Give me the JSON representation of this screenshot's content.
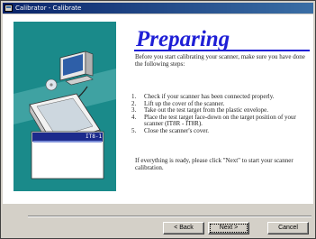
{
  "window": {
    "title": "Calibrator - Calibrate"
  },
  "page": {
    "heading": "Preparing",
    "intro": "Before you start calibrating your scanner, make sure you have done the following steps:",
    "steps": [
      {
        "num": "1.",
        "text": "Check if your scanner has been connected properly."
      },
      {
        "num": "2.",
        "text": "Lift up the cover of the scanner."
      },
      {
        "num": "3.",
        "text": "Take out the test target from the plastic envelope."
      },
      {
        "num": "4.",
        "text": "Place the test target face-down on the target position of your scanner (IT8R - IT8R)."
      },
      {
        "num": "5.",
        "text": "Close the scanner's cover."
      }
    ],
    "outro": "If everything is ready, please click \"Next\" to start your scanner calibration."
  },
  "illustration": {
    "target_label": "IT8-1"
  },
  "buttons": {
    "back": "< Back",
    "next": "Next >",
    "cancel": "Cancel"
  },
  "colors": {
    "title_bar": "#0a246a",
    "heading": "#1f1fd6",
    "illustration_bg": "#1a8a8a"
  }
}
